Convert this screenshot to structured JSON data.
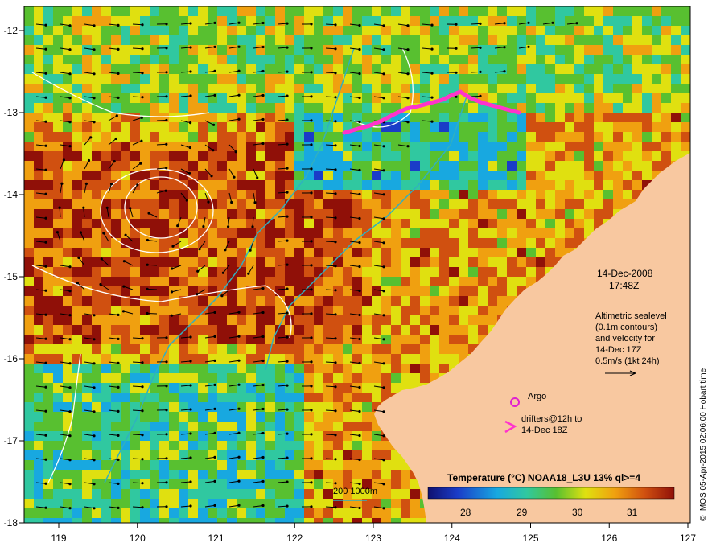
{
  "map": {
    "longitude_ticks": [
      "119",
      "120",
      "121",
      "122",
      "123",
      "124",
      "125",
      "126",
      "127"
    ],
    "latitude_ticks": [
      "-12",
      "-13",
      "-14",
      "-15",
      "-16",
      "-17",
      "-18"
    ]
  },
  "annotations": {
    "date": "14-Dec-2008",
    "time": "17:48Z",
    "altimetry_lines": [
      "Altimetric sealevel",
      "(0.1m contours)",
      "and velocity for",
      "14-Dec 17Z",
      "0.5m/s (1kt 24h)"
    ],
    "argo_label": "Argo",
    "drifters_lines": [
      "drifters@12h to",
      "14-Dec 18Z"
    ],
    "depth_contours_label": "200  1000m"
  },
  "colorbar": {
    "title": "Temperature (°C) NOAA18_L3U 13% ql>=4",
    "tick_labels": [
      "28",
      "29",
      "30",
      "31"
    ]
  },
  "credit": "© IMOS 05-Apr-2015 02:06:00 Hobart time",
  "colors": {
    "land": "#f8c8a0",
    "argo_marker": "#e020d0",
    "drifters": "#ff33cc",
    "shelf_contour": "#30b0c0",
    "sea_level_contour": "#ffffff"
  }
}
